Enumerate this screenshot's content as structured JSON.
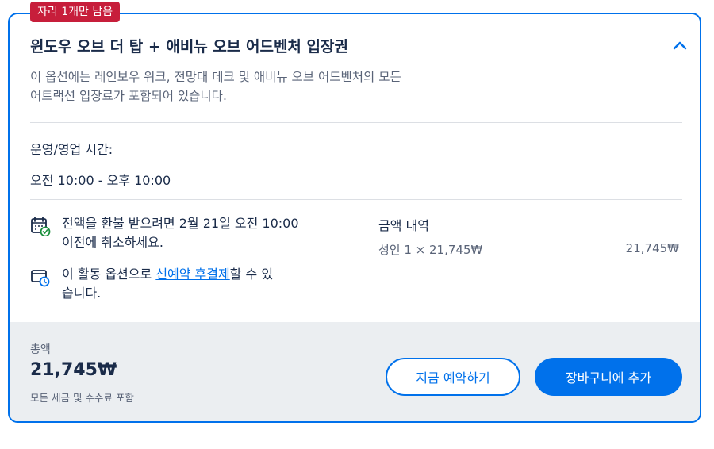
{
  "badge": "자리 1개만 남음",
  "option": {
    "title": "윈도우 오브 더 탑 + 애비뉴 오브 어드벤처 입장권",
    "description_line1": "이 옵션에는 레인보우 워크, 전망대 데크 및 애비뉴 오브 어드벤처의 모든",
    "description_line2": "어트랙션 입장료가 포함되어 있습니다."
  },
  "hours": {
    "label": "운영/영업 시간:",
    "value": "오전 10:00 - 오후 10:00"
  },
  "refund": {
    "line1": "전액을 환불 받으려면 2월 21일 오전 10:00",
    "line2": "이전에 취소하세요."
  },
  "reserve": {
    "prefix": "이 활동 옵션으로 ",
    "link": "선예약 후결제",
    "suffix_line1": "할 수 있",
    "line2": "습니다."
  },
  "price": {
    "heading": "금액 내역",
    "line_label": "성인 1 × 21,745₩",
    "line_amount": "21,745₩"
  },
  "footer": {
    "total_label": "총액",
    "total_amount": "21,745₩",
    "total_note": "모든 세금 및 수수료 포함",
    "reserve_button": "지금 예약하기",
    "cart_button": "장바구니에 추가"
  },
  "colors": {
    "accent": "#0071eb",
    "badge": "#c71e3b",
    "text": "#1a2b49",
    "muted": "#5a6478",
    "footer_bg": "#ebeef1"
  },
  "icons": {
    "collapse": "chevron-up-icon",
    "refund": "calendar-check-icon",
    "reserve": "wallet-clock-icon"
  }
}
